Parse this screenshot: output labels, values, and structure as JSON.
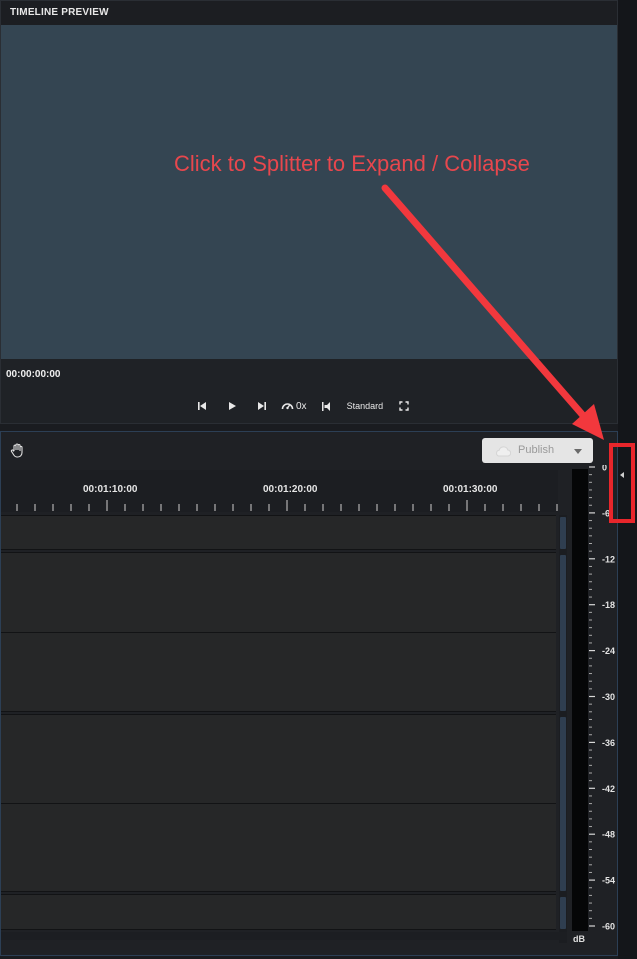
{
  "preview": {
    "title": "TIMELINE PREVIEW",
    "timecode": "00:00:00:00",
    "speed_label": "0x",
    "quality_label": "Standard"
  },
  "toolbar": {
    "publish_label": "Publish"
  },
  "ruler": {
    "labels": [
      "00:01:10:00",
      "00:01:20:00",
      "00:01:30:00"
    ]
  },
  "meter": {
    "scale": [
      "0",
      "-6",
      "-12",
      "-18",
      "-24",
      "-30",
      "-36",
      "-42",
      "-48",
      "-54",
      "-60"
    ],
    "unit": "dB"
  },
  "annotation": {
    "text": "Click to Splitter to Expand / Collapse"
  },
  "colors": {
    "annotation": "#e8474d",
    "highlight_box": "#e8262b",
    "preview_screen": "#344552"
  },
  "icons": [
    "skip-back-icon",
    "play-icon",
    "skip-forward-icon",
    "speed-gauge-icon",
    "volume-icon",
    "fullscreen-icon",
    "hand-icon",
    "upload-icon",
    "caret-down-icon",
    "collapse-arrow-icon"
  ]
}
